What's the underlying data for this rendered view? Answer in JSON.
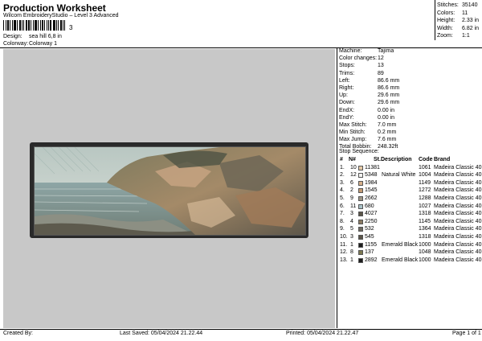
{
  "header": {
    "title": "Production Worksheet",
    "subtitle": "Wilcom EmbroideryStudio – Level 3 Advanced",
    "barcode_digit": "3",
    "design_label": "Design:",
    "design_value": "sea hill 6,8 in",
    "colorway_label": "Colorway:",
    "colorway_value": "Colorway 1"
  },
  "stats": [
    {
      "label": "Stitches:",
      "value": "35140"
    },
    {
      "label": "Colors:",
      "value": "11"
    },
    {
      "label": "Height:",
      "value": "2.33 in"
    },
    {
      "label": "Width:",
      "value": "6.82 in"
    },
    {
      "label": "Zoom:",
      "value": "1:1"
    }
  ],
  "details": [
    {
      "label": "Machine:",
      "value": "Tajima"
    },
    {
      "label": "Color changes:",
      "value": "12"
    },
    {
      "label": "Stops:",
      "value": "13"
    },
    {
      "label": "Trims:",
      "value": "89"
    },
    {
      "label": "Left:",
      "value": "86.6 mm"
    },
    {
      "label": "Right:",
      "value": "86.6 mm"
    },
    {
      "label": "Up:",
      "value": "29.6 mm"
    },
    {
      "label": "Down:",
      "value": "29.6 mm"
    },
    {
      "label": "EndX:",
      "value": "0.00 in"
    },
    {
      "label": "EndY:",
      "value": "0.00 in"
    },
    {
      "label": "Max Stitch:",
      "value": "7.0 mm"
    },
    {
      "label": "Min Stitch:",
      "value": "0.2 mm"
    },
    {
      "label": "Max Jump:",
      "value": "7.6 mm"
    },
    {
      "label": "Total Bobbin:",
      "value": "248.32ft"
    }
  ],
  "sequence": {
    "title": "Stop Sequence:",
    "headers": {
      "stop": "#",
      "n": "N#",
      "st": "St.",
      "desc": "Description",
      "code": "Code",
      "brand": "Brand"
    },
    "rows": [
      {
        "stop": "1.",
        "n": "10",
        "color": "#e4c9a6",
        "st": "11381",
        "desc": "",
        "code": "1061",
        "brand": "Madeira Classic 40"
      },
      {
        "stop": "2.",
        "n": "12",
        "color": "#f4f4f2",
        "st": "5348",
        "desc": "Natural White",
        "code": "1004",
        "brand": "Madeira Classic 40"
      },
      {
        "stop": "3.",
        "n": "6",
        "color": "#d6b08a",
        "st": "1984",
        "desc": "",
        "code": "1149",
        "brand": "Madeira Classic 40"
      },
      {
        "stop": "4.",
        "n": "2",
        "color": "#c49a72",
        "st": "1545",
        "desc": "",
        "code": "1272",
        "brand": "Madeira Classic 40"
      },
      {
        "stop": "5.",
        "n": "9",
        "color": "#9c9484",
        "st": "2662",
        "desc": "",
        "code": "1288",
        "brand": "Madeira Classic 40"
      },
      {
        "stop": "6.",
        "n": "11",
        "color": "#a9c2c8",
        "st": "680",
        "desc": "",
        "code": "1027",
        "brand": "Madeira Classic 40"
      },
      {
        "stop": "7.",
        "n": "3",
        "color": "#5a5448",
        "st": "4027",
        "desc": "",
        "code": "1318",
        "brand": "Madeira Classic 40"
      },
      {
        "stop": "8.",
        "n": "4",
        "color": "#8a7a62",
        "st": "2250",
        "desc": "",
        "code": "1145",
        "brand": "Madeira Classic 40"
      },
      {
        "stop": "9.",
        "n": "5",
        "color": "#6e6a60",
        "st": "532",
        "desc": "",
        "code": "1364",
        "brand": "Madeira Classic 40"
      },
      {
        "stop": "10.",
        "n": "3",
        "color": "#5a5448",
        "st": "545",
        "desc": "",
        "code": "1318",
        "brand": "Madeira Classic 40"
      },
      {
        "stop": "11.",
        "n": "1",
        "color": "#1e1e1e",
        "st": "1155",
        "desc": "Emerald Black",
        "code": "1000",
        "brand": "Madeira Classic 40"
      },
      {
        "stop": "12.",
        "n": "8",
        "color": "#7c7850",
        "st": "137",
        "desc": "",
        "code": "1048",
        "brand": "Madeira Classic 40"
      },
      {
        "stop": "13.",
        "n": "1",
        "color": "#1e1e1e",
        "st": "2892",
        "desc": "Emerald Black",
        "code": "1000",
        "brand": "Madeira Classic 40"
      }
    ]
  },
  "footer": {
    "created_by": "Created By:",
    "last_saved": "Last Saved: 05/04/2024 21.22.44",
    "printed": "Printed: 05/04/2024 21.22.47",
    "page": "Page 1 of 1"
  }
}
